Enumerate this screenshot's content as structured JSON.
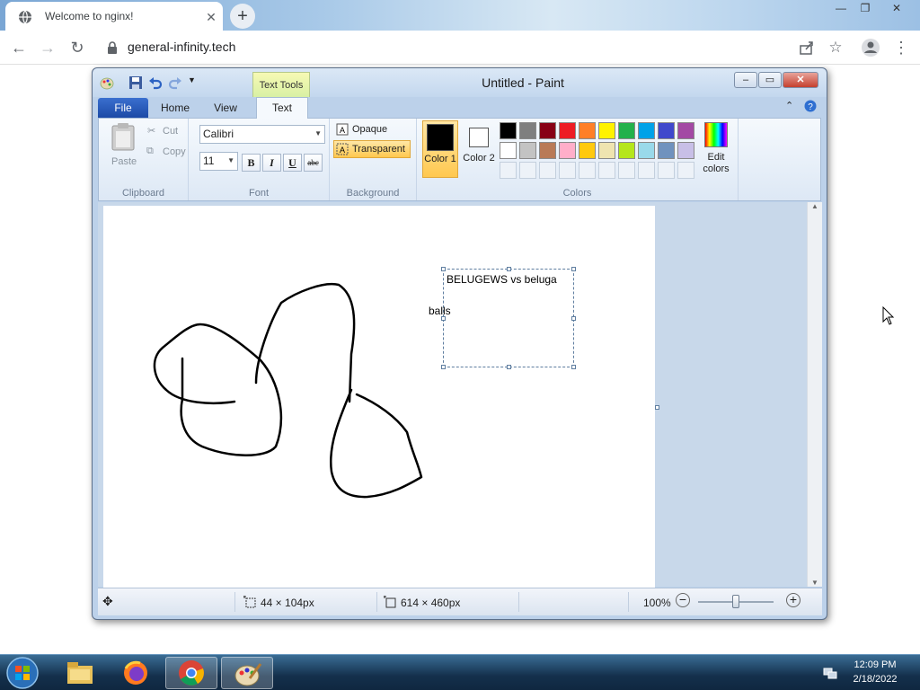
{
  "browser": {
    "tab_title": "Welcome to nginx!",
    "tab_close": "✕",
    "new_tab": "+",
    "url": "general-infinity.tech"
  },
  "paint": {
    "title": "Untitled - Paint",
    "context_tab": "Text Tools",
    "tabs": {
      "file": "File",
      "home": "Home",
      "view": "View",
      "text": "Text"
    },
    "clipboard": {
      "paste": "Paste",
      "cut": "Cut",
      "copy": "Copy",
      "label": "Clipboard"
    },
    "font": {
      "family": "Calibri",
      "size": "11",
      "bold": "B",
      "italic": "I",
      "underline": "U",
      "strike": "abc",
      "label": "Font"
    },
    "background": {
      "opaque": "Opaque",
      "transparent": "Transparent",
      "label": "Background"
    },
    "colors": {
      "color1": "Color 1",
      "color2": "Color 2",
      "edit": "Edit colors",
      "label": "Colors",
      "color1_value": "#000000",
      "color2_value": "#ffffff",
      "palette_row1": [
        "#000000",
        "#7f7f7f",
        "#880015",
        "#ed1c24",
        "#ff7f27",
        "#fff200",
        "#22b14c",
        "#00a2e8",
        "#3f48cc",
        "#a349a4"
      ],
      "palette_row2": [
        "#ffffff",
        "#c3c3c3",
        "#b97a57",
        "#ffaec9",
        "#ffc90e",
        "#efe4b0",
        "#b5e61d",
        "#99d9ea",
        "#7092be",
        "#c8bfe7"
      ]
    },
    "canvas": {
      "text_line1": "BELUGEWS vs beluga",
      "text_line2": "balls"
    },
    "status": {
      "selection": "44 × 104px",
      "size": "614 × 460px",
      "zoom": "100%"
    }
  },
  "taskbar": {
    "time": "12:09 PM",
    "date": "2/18/2022"
  },
  "icons": [
    "globe-icon",
    "close-icon",
    "plus-icon",
    "back-icon",
    "forward-icon",
    "reload-icon",
    "lock-icon",
    "share-icon",
    "star-icon",
    "profile-icon",
    "menu-icon",
    "paint-app-icon",
    "save-icon",
    "undo-icon",
    "redo-icon",
    "customize-qat-icon",
    "minimize-icon",
    "maximize-icon",
    "help-icon",
    "paste-icon",
    "cut-icon",
    "copy-icon",
    "opaque-icon",
    "transparent-icon",
    "rainbow-icon",
    "move-icon",
    "selection-size-icon",
    "canvas-size-icon",
    "zoom-out-icon",
    "zoom-in-icon",
    "start-orb-icon",
    "explorer-icon",
    "firefox-icon",
    "chrome-icon",
    "paint-taskbar-icon",
    "network-icon",
    "mouse-cursor-icon"
  ]
}
